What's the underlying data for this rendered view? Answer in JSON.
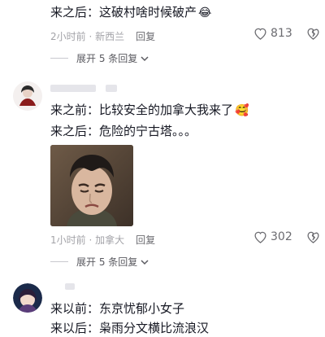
{
  "comment1": {
    "after_line": "来之后：这破村啥时候破产",
    "emoji": "😂",
    "meta": "2小时前 · 新西兰",
    "reply": "回复",
    "likes": "813",
    "expand": "展开 5 条回复"
  },
  "comment2": {
    "line1": "来之前：比较安全的加拿大我来了",
    "emoji": "🥰",
    "line2": "来之后：危险的宁古塔。。。",
    "meta": "1小时前 · 加拿大",
    "reply": "回复",
    "likes": "302",
    "expand": "展开 5 条回复"
  },
  "comment3": {
    "line1": "来以前：东京忧郁小女子",
    "line2_partial": "来以后：枭雨分文横比流浪汉"
  },
  "colors": {
    "text": "#161823",
    "meta": "#a3a3a8",
    "placeholder": "#e5e5ea"
  }
}
